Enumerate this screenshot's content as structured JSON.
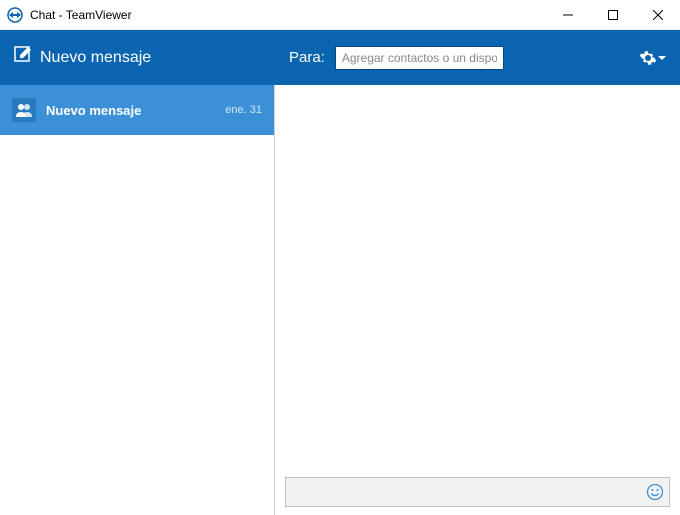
{
  "titlebar": {
    "title": "Chat - TeamViewer"
  },
  "header": {
    "newMessageLabel": "Nuevo mensaje",
    "toLabel": "Para:",
    "recipientPlaceholder": "Agregar contactos o un dispositivo..."
  },
  "sidebar": {
    "items": [
      {
        "title": "Nuevo mensaje",
        "date": "ene. 31"
      }
    ]
  },
  "compose": {
    "placeholder": ""
  },
  "colors": {
    "brand": "#0a64af",
    "selected": "#3b90d8"
  }
}
